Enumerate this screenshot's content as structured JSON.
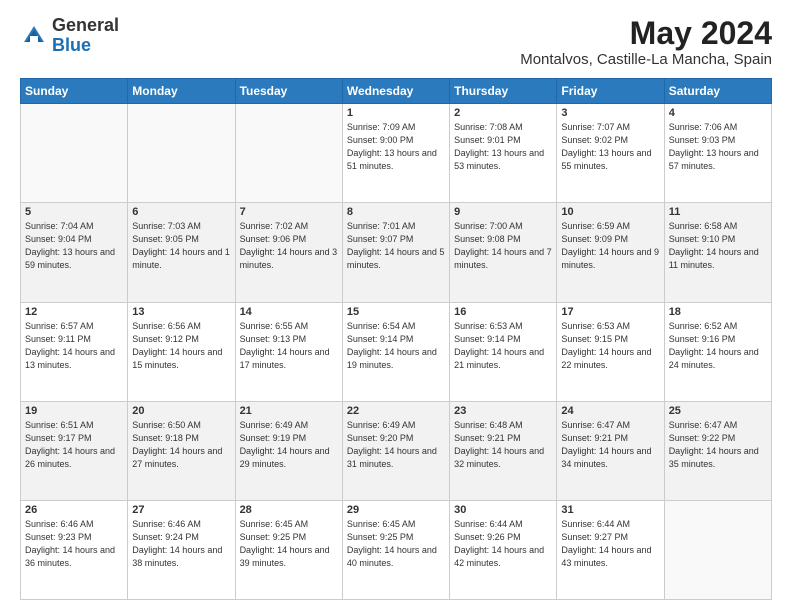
{
  "header": {
    "logo_general": "General",
    "logo_blue": "Blue",
    "month_title": "May 2024",
    "location": "Montalvos, Castille-La Mancha, Spain"
  },
  "days_of_week": [
    "Sunday",
    "Monday",
    "Tuesday",
    "Wednesday",
    "Thursday",
    "Friday",
    "Saturday"
  ],
  "weeks": [
    [
      {
        "day": "",
        "content": ""
      },
      {
        "day": "",
        "content": ""
      },
      {
        "day": "",
        "content": ""
      },
      {
        "day": "1",
        "content": "Sunrise: 7:09 AM\nSunset: 9:00 PM\nDaylight: 13 hours\nand 51 minutes."
      },
      {
        "day": "2",
        "content": "Sunrise: 7:08 AM\nSunset: 9:01 PM\nDaylight: 13 hours\nand 53 minutes."
      },
      {
        "day": "3",
        "content": "Sunrise: 7:07 AM\nSunset: 9:02 PM\nDaylight: 13 hours\nand 55 minutes."
      },
      {
        "day": "4",
        "content": "Sunrise: 7:06 AM\nSunset: 9:03 PM\nDaylight: 13 hours\nand 57 minutes."
      }
    ],
    [
      {
        "day": "5",
        "content": "Sunrise: 7:04 AM\nSunset: 9:04 PM\nDaylight: 13 hours\nand 59 minutes."
      },
      {
        "day": "6",
        "content": "Sunrise: 7:03 AM\nSunset: 9:05 PM\nDaylight: 14 hours\nand 1 minute."
      },
      {
        "day": "7",
        "content": "Sunrise: 7:02 AM\nSunset: 9:06 PM\nDaylight: 14 hours\nand 3 minutes."
      },
      {
        "day": "8",
        "content": "Sunrise: 7:01 AM\nSunset: 9:07 PM\nDaylight: 14 hours\nand 5 minutes."
      },
      {
        "day": "9",
        "content": "Sunrise: 7:00 AM\nSunset: 9:08 PM\nDaylight: 14 hours\nand 7 minutes."
      },
      {
        "day": "10",
        "content": "Sunrise: 6:59 AM\nSunset: 9:09 PM\nDaylight: 14 hours\nand 9 minutes."
      },
      {
        "day": "11",
        "content": "Sunrise: 6:58 AM\nSunset: 9:10 PM\nDaylight: 14 hours\nand 11 minutes."
      }
    ],
    [
      {
        "day": "12",
        "content": "Sunrise: 6:57 AM\nSunset: 9:11 PM\nDaylight: 14 hours\nand 13 minutes."
      },
      {
        "day": "13",
        "content": "Sunrise: 6:56 AM\nSunset: 9:12 PM\nDaylight: 14 hours\nand 15 minutes."
      },
      {
        "day": "14",
        "content": "Sunrise: 6:55 AM\nSunset: 9:13 PM\nDaylight: 14 hours\nand 17 minutes."
      },
      {
        "day": "15",
        "content": "Sunrise: 6:54 AM\nSunset: 9:14 PM\nDaylight: 14 hours\nand 19 minutes."
      },
      {
        "day": "16",
        "content": "Sunrise: 6:53 AM\nSunset: 9:14 PM\nDaylight: 14 hours\nand 21 minutes."
      },
      {
        "day": "17",
        "content": "Sunrise: 6:53 AM\nSunset: 9:15 PM\nDaylight: 14 hours\nand 22 minutes."
      },
      {
        "day": "18",
        "content": "Sunrise: 6:52 AM\nSunset: 9:16 PM\nDaylight: 14 hours\nand 24 minutes."
      }
    ],
    [
      {
        "day": "19",
        "content": "Sunrise: 6:51 AM\nSunset: 9:17 PM\nDaylight: 14 hours\nand 26 minutes."
      },
      {
        "day": "20",
        "content": "Sunrise: 6:50 AM\nSunset: 9:18 PM\nDaylight: 14 hours\nand 27 minutes."
      },
      {
        "day": "21",
        "content": "Sunrise: 6:49 AM\nSunset: 9:19 PM\nDaylight: 14 hours\nand 29 minutes."
      },
      {
        "day": "22",
        "content": "Sunrise: 6:49 AM\nSunset: 9:20 PM\nDaylight: 14 hours\nand 31 minutes."
      },
      {
        "day": "23",
        "content": "Sunrise: 6:48 AM\nSunset: 9:21 PM\nDaylight: 14 hours\nand 32 minutes."
      },
      {
        "day": "24",
        "content": "Sunrise: 6:47 AM\nSunset: 9:21 PM\nDaylight: 14 hours\nand 34 minutes."
      },
      {
        "day": "25",
        "content": "Sunrise: 6:47 AM\nSunset: 9:22 PM\nDaylight: 14 hours\nand 35 minutes."
      }
    ],
    [
      {
        "day": "26",
        "content": "Sunrise: 6:46 AM\nSunset: 9:23 PM\nDaylight: 14 hours\nand 36 minutes."
      },
      {
        "day": "27",
        "content": "Sunrise: 6:46 AM\nSunset: 9:24 PM\nDaylight: 14 hours\nand 38 minutes."
      },
      {
        "day": "28",
        "content": "Sunrise: 6:45 AM\nSunset: 9:25 PM\nDaylight: 14 hours\nand 39 minutes."
      },
      {
        "day": "29",
        "content": "Sunrise: 6:45 AM\nSunset: 9:25 PM\nDaylight: 14 hours\nand 40 minutes."
      },
      {
        "day": "30",
        "content": "Sunrise: 6:44 AM\nSunset: 9:26 PM\nDaylight: 14 hours\nand 42 minutes."
      },
      {
        "day": "31",
        "content": "Sunrise: 6:44 AM\nSunset: 9:27 PM\nDaylight: 14 hours\nand 43 minutes."
      },
      {
        "day": "",
        "content": ""
      }
    ]
  ]
}
